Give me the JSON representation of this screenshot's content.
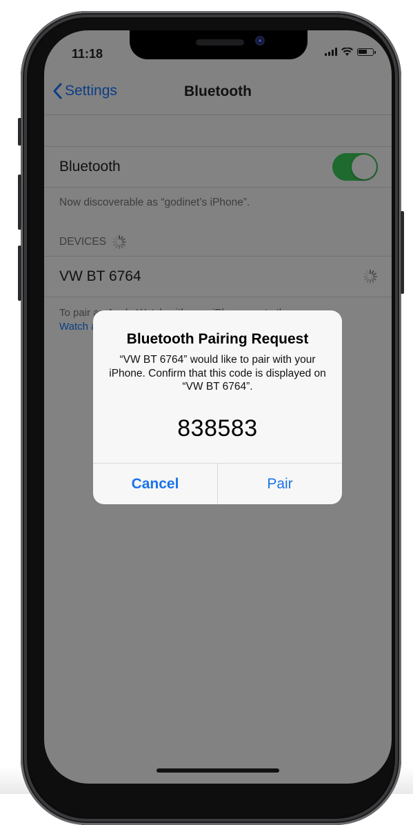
{
  "status_bar": {
    "time": "11:18",
    "icons": [
      "signal-icon",
      "wifi-icon",
      "battery-icon"
    ]
  },
  "nav": {
    "back_label": "Settings",
    "title": "Bluetooth"
  },
  "bluetooth_row": {
    "label": "Bluetooth",
    "toggle_on": true
  },
  "discoverable_text": "Now discoverable as “godinet’s iPhone”.",
  "devices": {
    "header": "DEVICES",
    "items": [
      {
        "name": "VW BT 6764",
        "status": "connecting"
      }
    ]
  },
  "footer": {
    "line1": "To pair an Apple Watch with your iPhone, go to the",
    "link": "Watch app."
  },
  "alert": {
    "title": "Bluetooth Pairing Request",
    "message": "“VW BT 6764” would like to pair with your iPhone. Confirm that this code is displayed on “VW BT 6764”.",
    "code": "838583",
    "cancel_label": "Cancel",
    "pair_label": "Pair"
  },
  "colors": {
    "accent": "#1a73e8",
    "toggle_on": "#34c759",
    "dim_overlay": "#828282"
  }
}
